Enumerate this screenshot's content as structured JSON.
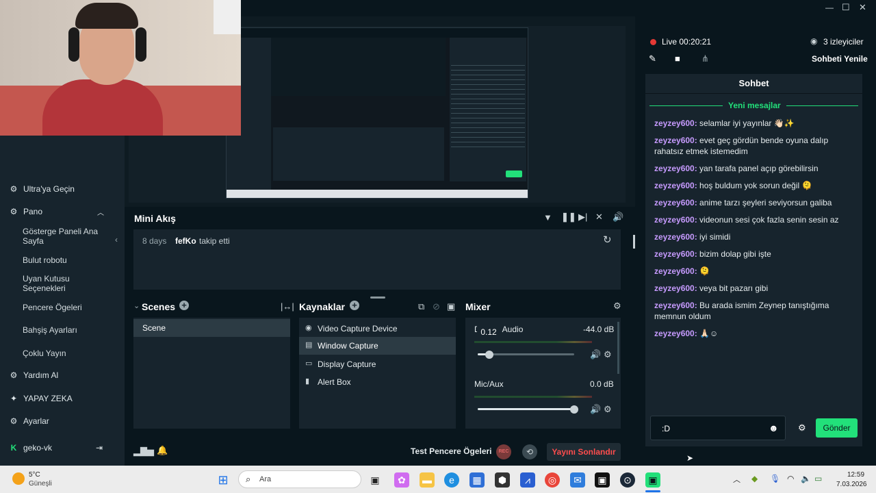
{
  "sidebar": {
    "items": [
      {
        "label": "Ultra'ya Geçin",
        "icon": "ultra-icon"
      },
      {
        "label": "Pano",
        "icon": "dashboard-icon"
      },
      {
        "label": "Yardım Al",
        "icon": "help-icon"
      },
      {
        "label": "YAPAY ZEKA",
        "icon": "ai-sparkle-icon"
      },
      {
        "label": "Ayarlar",
        "icon": "gear-icon"
      }
    ],
    "subitems": [
      "Gösterge Paneli Ana Sayfa",
      "Bulut robotu",
      "Uyan Kutusu Seçenekleri",
      "Pencere Ögeleri",
      "Bahşiş Ayarları",
      "Çoklu Yayın"
    ],
    "account": "geko-vk"
  },
  "minifeed": {
    "title": "Mini Akış",
    "entry": {
      "time": "8 days",
      "user": "fefKo",
      "action": "takip etti"
    }
  },
  "scenes": {
    "title": "Scenes",
    "items": [
      "Scene"
    ]
  },
  "sources": {
    "title": "Kaynaklar",
    "items": [
      "Video Capture Device",
      "Window Capture",
      "Display Capture",
      "Alert Box"
    ]
  },
  "mixer": {
    "title": "Mixer",
    "tooltip": "0.12",
    "channels": [
      {
        "name": "Desktop Audio",
        "visible_name": "D",
        "visible_name_tail": "Audio",
        "db": "-44.0 dB",
        "level": 0.12
      },
      {
        "name": "Mic/Aux",
        "db": "0.0 dB",
        "level": 1.0
      }
    ]
  },
  "bottom": {
    "test_label": "Test Pencere Ögeleri",
    "rec": "REC",
    "end_stream": "Yayını Sonlandır"
  },
  "stream": {
    "live": "Live 00:20:21",
    "viewers": "3 izleyiciler",
    "refresh": "Sohbeti Yenile"
  },
  "chat": {
    "title": "Sohbet",
    "new_messages": "Yeni mesajlar",
    "messages": [
      {
        "user": "zeyzey600:",
        "text": " selamlar iyi yayınlar 👋🏻✨"
      },
      {
        "user": "zeyzey600:",
        "text": " evet geç gördün bende oyuna dalıp rahatsız etmek istemedim"
      },
      {
        "user": "zeyzey600:",
        "text": " yan tarafa panel açıp görebilirsin"
      },
      {
        "user": "zeyzey600:",
        "text": " hoş buldum yok sorun değil 🫠"
      },
      {
        "user": "zeyzey600:",
        "text": " anime tarzı şeyleri seviyorsun galiba"
      },
      {
        "user": "zeyzey600:",
        "text": " videonun sesi çok fazla senin sesin az"
      },
      {
        "user": "zeyzey600:",
        "text": " iyi simidi"
      },
      {
        "user": "zeyzey600:",
        "text": " bizim dolap gibi işte"
      },
      {
        "user": "zeyzey600:",
        "text": " 🫠"
      },
      {
        "user": "zeyzey600:",
        "text": " veya bit pazarı gibi"
      },
      {
        "user": "zeyzey600:",
        "text": " Bu arada ismim Zeynep tanıştığıma memnun oldum"
      },
      {
        "user": "zeyzey600:",
        "text": " 🙏🏻☺"
      }
    ],
    "input_value": ":D",
    "send": "Gönder"
  },
  "taskbar": {
    "weather_temp": "5°C",
    "weather_desc": "Güneşli",
    "search": "Ara",
    "time": "12:59",
    "date": "7.03.2026"
  },
  "colors": {
    "accent": "#22e07a",
    "live": "#e53935",
    "username": "#c79bff",
    "end_stream": "#ff4d4d"
  }
}
